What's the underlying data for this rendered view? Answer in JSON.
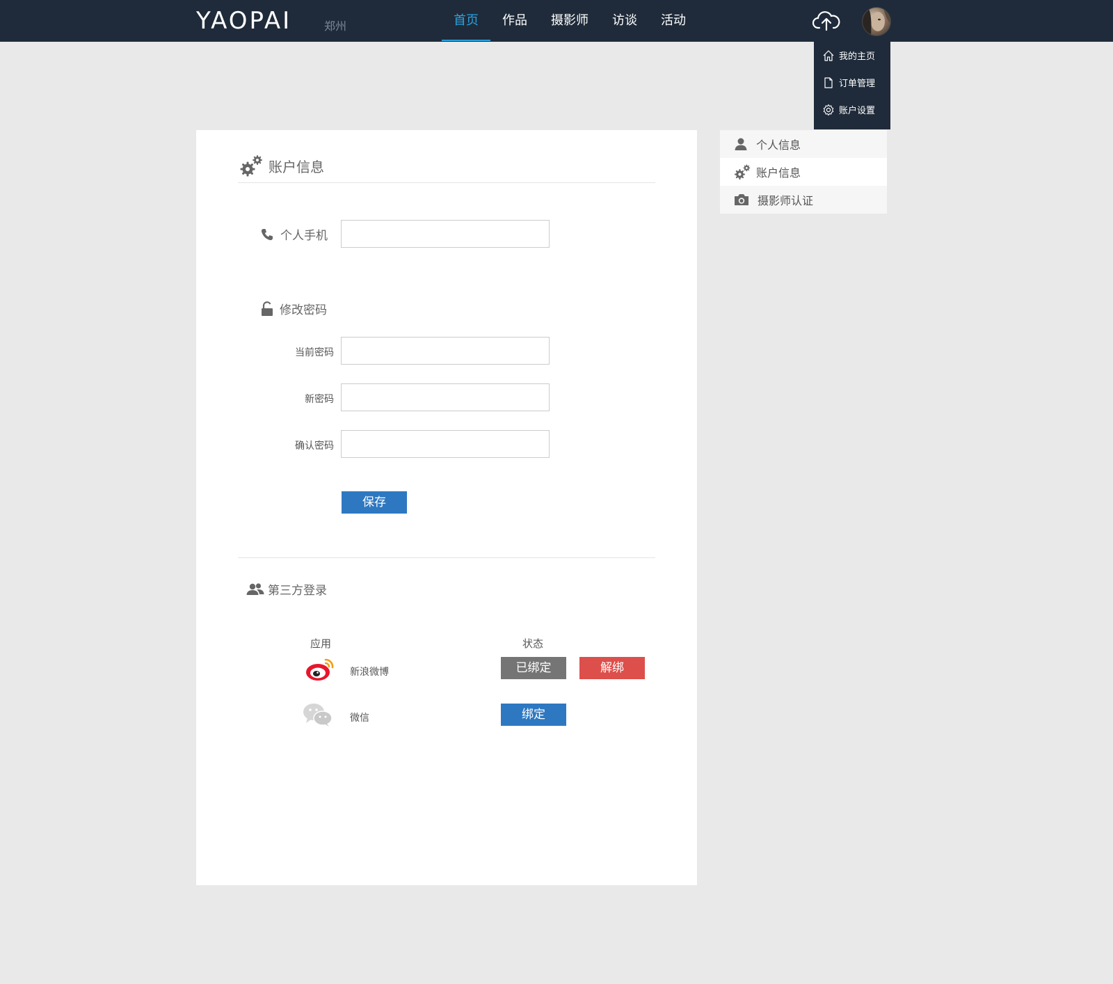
{
  "header": {
    "logo": "YAOPAI",
    "city": "郑州",
    "nav": [
      "首页",
      "作品",
      "摄影师",
      "访谈",
      "活动"
    ],
    "active_nav": "首页"
  },
  "dropdown": {
    "items": [
      {
        "label": "我的主页",
        "icon": "home-icon"
      },
      {
        "label": "订单管理",
        "icon": "document-icon"
      },
      {
        "label": "账户设置",
        "icon": "gear-icon"
      }
    ]
  },
  "panel": {
    "title": "账户信息",
    "phone_label": "个人手机",
    "phone_value": "",
    "password_section": "修改密码",
    "current_password_label": "当前密码",
    "new_password_label": "新密码",
    "confirm_password_label": "确认密码",
    "save_label": "保存",
    "third_party_title": "第三方登录",
    "col_app": "应用",
    "col_status": "状态",
    "apps": [
      {
        "name": "新浪微博",
        "icon": "weibo-icon",
        "status_label": "已绑定",
        "action_label": "解绑"
      },
      {
        "name": "微信",
        "icon": "wechat-icon",
        "status_label": "绑定"
      }
    ]
  },
  "sidemenu": {
    "items": [
      {
        "label": "个人信息",
        "icon": "user-icon"
      },
      {
        "label": "账户信息",
        "icon": "gears-icon"
      },
      {
        "label": "摄影师认证",
        "icon": "camera-icon"
      }
    ],
    "active": "账户信息"
  },
  "colors": {
    "topbar": "#1f2b3a",
    "accent": "#28a4e3",
    "primary_button": "#2e78c1",
    "danger_button": "#dd4f4b",
    "neutral_button": "#757575",
    "background": "#e9e9e9"
  }
}
